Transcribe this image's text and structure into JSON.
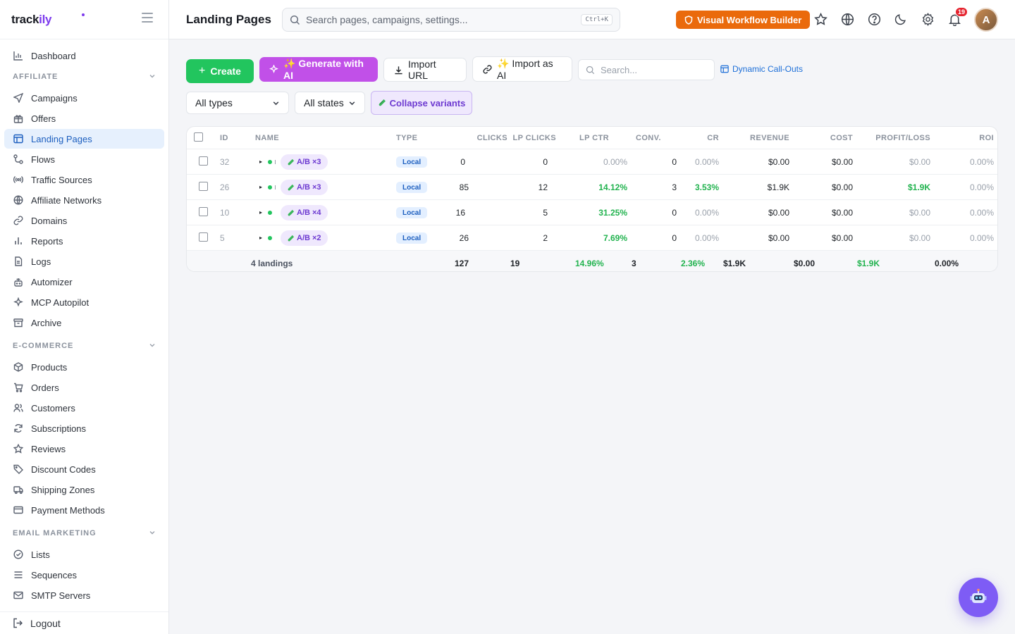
{
  "brand": {
    "part1": "track",
    "part2": "ily"
  },
  "header": {
    "title": "Landing Pages",
    "search_placeholder": "Search pages, campaigns, settings...",
    "search_shortcut": "Ctrl+K",
    "workflow_button": "Visual Workflow Builder",
    "notifications_count": "19",
    "avatar_initial": "A"
  },
  "sidebar": {
    "dashboard": "Dashboard",
    "sections": {
      "affiliate": "AFFILIATE",
      "ecommerce": "E-COMMERCE",
      "email": "EMAIL MARKETING"
    },
    "affiliate_items": [
      "Campaigns",
      "Offers",
      "Landing Pages",
      "Flows",
      "Traffic Sources",
      "Affiliate Networks",
      "Domains",
      "Reports",
      "Logs",
      "Automizer",
      "MCP Autopilot",
      "Archive"
    ],
    "ecommerce_items": [
      "Products",
      "Orders",
      "Customers",
      "Subscriptions",
      "Reviews",
      "Discount Codes",
      "Shipping Zones",
      "Payment Methods"
    ],
    "email_items": [
      "Lists",
      "Sequences",
      "SMTP Servers"
    ],
    "logout": "Logout",
    "active": "Landing Pages"
  },
  "toolbar": {
    "create": "Create",
    "generate_ai": "✨ Generate with AI",
    "import_url": "Import URL",
    "import_ai": "✨ Import as AI",
    "search_placeholder": "Search...",
    "dynamic_callouts": "Dynamic Call-Outs",
    "filter_types": "All types",
    "filter_states": "All states",
    "collapse_variants": "Collapse variants"
  },
  "table": {
    "columns": [
      "ID",
      "NAME",
      "TYPE",
      "CLICKS",
      "LP CLICKS",
      "LP CTR",
      "CONV.",
      "CR",
      "REVENUE",
      "COST",
      "PROFIT/LOSS",
      "ROI"
    ],
    "rows": [
      {
        "id": "32",
        "variant": "A/B ×3",
        "type": "Local",
        "clicks": "0",
        "lp_clicks": "0",
        "lp_ctr": "0.00%",
        "conv": "0",
        "cr": "0.00%",
        "revenue": "$0.00",
        "cost": "$0.00",
        "profit": "$0.00",
        "roi": "0.00%"
      },
      {
        "id": "26",
        "variant": "A/B ×3",
        "type": "Local",
        "clicks": "85",
        "lp_clicks": "12",
        "lp_ctr": "14.12%",
        "conv": "3",
        "cr": "3.53%",
        "revenue": "$1.9K",
        "cost": "$0.00",
        "profit": "$1.9K",
        "roi": "0.00%"
      },
      {
        "id": "10",
        "variant": "A/B ×4",
        "type": "Local",
        "clicks": "16",
        "lp_clicks": "5",
        "lp_ctr": "31.25%",
        "conv": "0",
        "cr": "0.00%",
        "revenue": "$0.00",
        "cost": "$0.00",
        "profit": "$0.00",
        "roi": "0.00%"
      },
      {
        "id": "5",
        "variant": "A/B ×2",
        "type": "Local",
        "clicks": "26",
        "lp_clicks": "2",
        "lp_ctr": "7.69%",
        "conv": "0",
        "cr": "0.00%",
        "revenue": "$0.00",
        "cost": "$0.00",
        "profit": "$0.00",
        "roi": "0.00%"
      }
    ],
    "footer": {
      "label": "4 landings",
      "clicks": "127",
      "lp_clicks": "19",
      "lp_ctr": "14.96%",
      "conv": "3",
      "cr": "2.36%",
      "revenue": "$1.9K",
      "cost": "$0.00",
      "profit": "$1.9K",
      "roi": "0.00%"
    }
  },
  "colors": {
    "accent": "#22c55e",
    "ai": "#c150e8",
    "warning": "#ea6a0c",
    "link": "#1d6fd8",
    "active_nav": "#e6f0fd"
  }
}
